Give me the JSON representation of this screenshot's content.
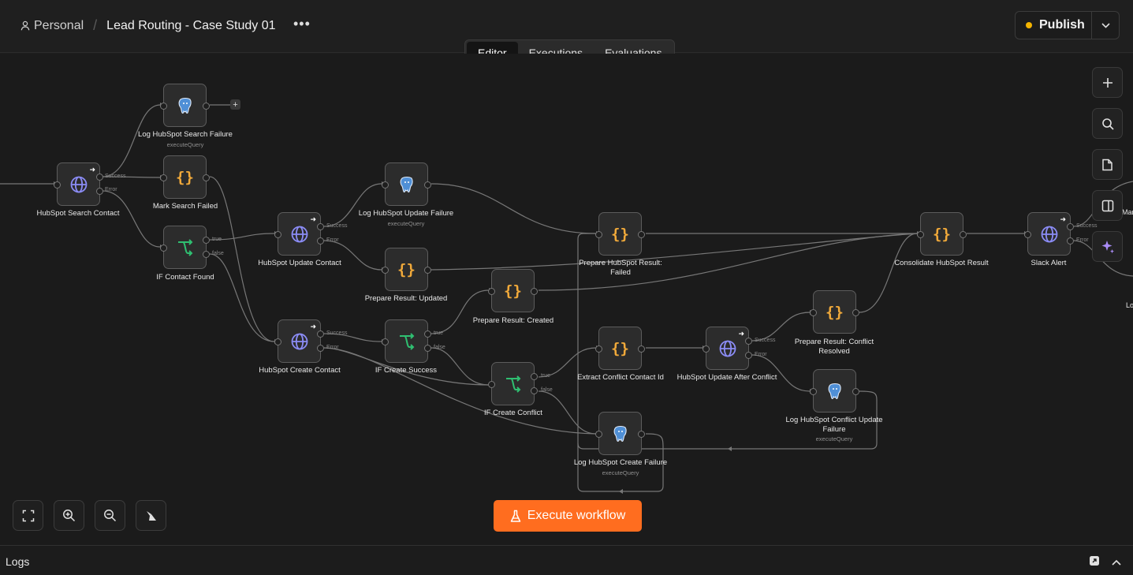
{
  "header": {
    "workspace": "Personal",
    "workflow_title": "Lead Routing - Case Study 01",
    "more_label": "•••",
    "publish_label": "Publish",
    "publish_status_color": "#f4b400"
  },
  "tabs": [
    "Editor",
    "Executions",
    "Evaluations"
  ],
  "active_tab": "Editor",
  "nodes": [
    {
      "id": "search",
      "type": "http",
      "label": "HubSpot Search Contact",
      "sub": "",
      "trigger": true
    },
    {
      "id": "logsearch",
      "type": "postgres",
      "label": "Log HubSpot Search Failure",
      "sub": "executeQuery"
    },
    {
      "id": "marksearch",
      "type": "code",
      "label": "Mark Search Failed",
      "sub": ""
    },
    {
      "id": "iffound",
      "type": "if",
      "label": "IF Contact Found",
      "sub": ""
    },
    {
      "id": "update",
      "type": "http",
      "label": "HubSpot Update Contact",
      "sub": "",
      "trigger": true
    },
    {
      "id": "logupdate",
      "type": "postgres",
      "label": "Log HubSpot Update Failure",
      "sub": "executeQuery"
    },
    {
      "id": "prepupdated",
      "type": "code",
      "label": "Prepare Result: Updated",
      "sub": ""
    },
    {
      "id": "create",
      "type": "http",
      "label": "HubSpot Create Contact",
      "sub": "",
      "trigger": true
    },
    {
      "id": "ifcreate",
      "type": "if",
      "label": "IF Create Success",
      "sub": ""
    },
    {
      "id": "prepcreated",
      "type": "code",
      "label": "Prepare Result: Created",
      "sub": ""
    },
    {
      "id": "ifconflict",
      "type": "if",
      "label": "IF Create Conflict",
      "sub": ""
    },
    {
      "id": "prepfailed",
      "type": "code",
      "label": "Prepare HubSpot Result: Failed",
      "sub": ""
    },
    {
      "id": "extract",
      "type": "code",
      "label": "Extract Conflict Contact Id",
      "sub": ""
    },
    {
      "id": "logcreate",
      "type": "postgres",
      "label": "Log HubSpot Create Failure",
      "sub": "executeQuery"
    },
    {
      "id": "updateafter",
      "type": "http",
      "label": "HubSpot Update After Conflict",
      "sub": "",
      "trigger": true
    },
    {
      "id": "prepresolved",
      "type": "code",
      "label": "Prepare Result: Conflict Resolved",
      "sub": ""
    },
    {
      "id": "logconflict",
      "type": "postgres",
      "label": "Log HubSpot Conflict Update Failure",
      "sub": "executeQuery"
    },
    {
      "id": "consolidate",
      "type": "code",
      "label": "Consolidate HubSpot Result",
      "sub": ""
    },
    {
      "id": "slack",
      "type": "http",
      "label": "Slack Alert",
      "sub": "",
      "trigger": true
    }
  ],
  "port_labels": {
    "success": "Success",
    "error": "Error",
    "true": "true",
    "false": "false"
  },
  "clipped_labels": [
    "Mar",
    "Lo"
  ],
  "add_node_symbol": "+",
  "execute_label": "Execute workflow",
  "logs_label": "Logs",
  "colors": {
    "accent": "#ff6d1f",
    "http_icon": "#8b8cf5",
    "code_icon": "#f0a93a",
    "if_icon": "#2fbf71",
    "postgres_icon": "#4f8fd6",
    "ai_icon": "#a98bf5"
  }
}
